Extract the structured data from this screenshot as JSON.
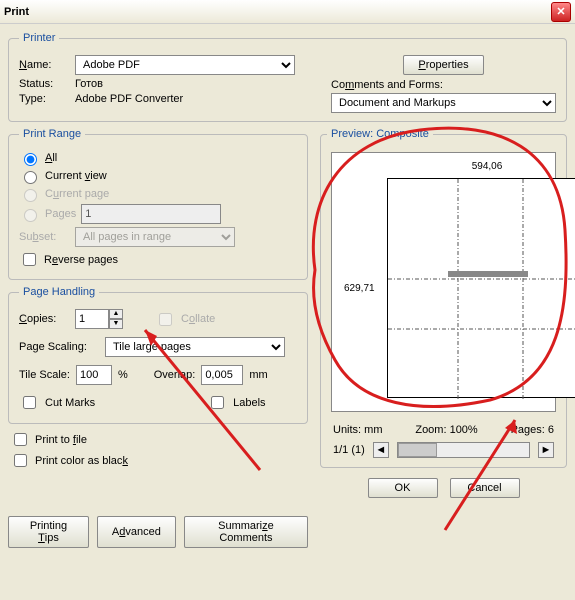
{
  "window": {
    "title": "Print"
  },
  "printer": {
    "legend": "Printer",
    "name_label": "Name:",
    "name_value": "Adobe PDF",
    "properties_btn": "Properties",
    "status_label": "Status:",
    "status_value": "Готов",
    "type_label": "Type:",
    "type_value": "Adobe PDF Converter",
    "comments_label": "Comments and Forms:",
    "comments_value": "Document and Markups"
  },
  "range": {
    "legend": "Print Range",
    "all": "All",
    "current_view": "Current view",
    "current_page": "Current page",
    "pages_label": "Pages",
    "pages_value": "1",
    "subset_label": "Subset:",
    "subset_value": "All pages in range",
    "reverse": "Reverse pages"
  },
  "handling": {
    "legend": "Page Handling",
    "copies_label": "Copies:",
    "copies_value": "1",
    "collate": "Collate",
    "scaling_label": "Page Scaling:",
    "scaling_value": "Tile large pages",
    "tilescale_label": "Tile Scale:",
    "tilescale_value": "100",
    "tilescale_unit": "%",
    "overlap_label": "Overlap:",
    "overlap_value": "0,005",
    "overlap_unit": "mm",
    "cutmarks": "Cut Marks",
    "labels": "Labels"
  },
  "preview": {
    "legend": "Preview: Composite",
    "width": "594,06",
    "height": "629,71",
    "units": "Units: mm",
    "zoom": "Zoom: 100%",
    "pages": "Pages: 6",
    "nav": "1/1 (1)"
  },
  "options": {
    "print_to_file": "Print to file",
    "print_as_black": "Print color as black"
  },
  "buttons": {
    "tips": "Printing Tips",
    "advanced": "Advanced",
    "summarize": "Summarize Comments",
    "ok": "OK",
    "cancel": "Cancel"
  }
}
